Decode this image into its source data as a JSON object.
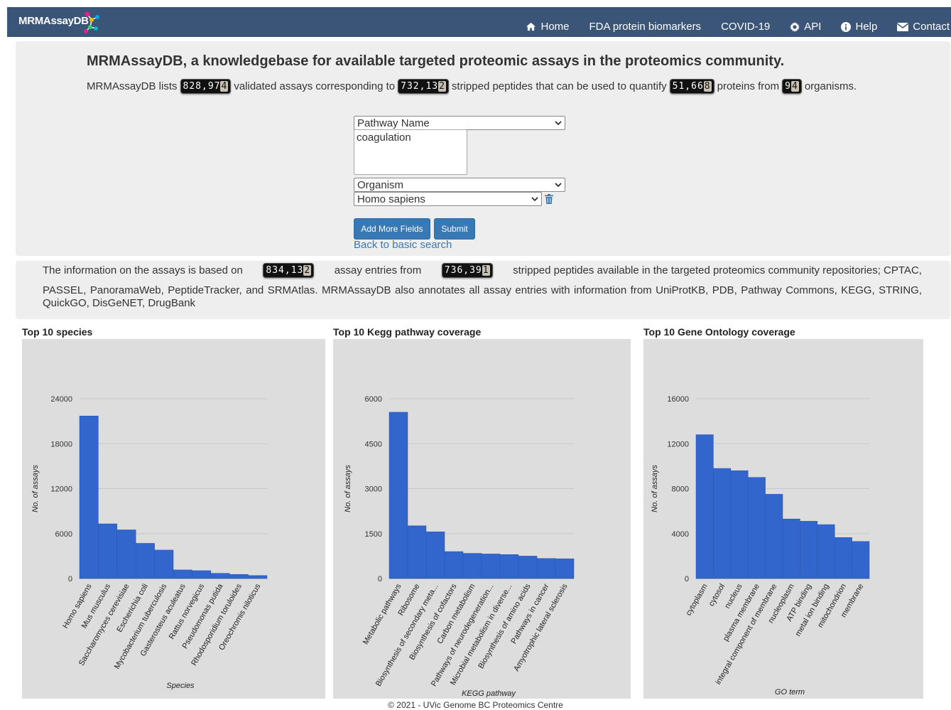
{
  "brand": {
    "name": "MRMAssayDB"
  },
  "nav": [
    {
      "label": "Home",
      "icon": "home-icon"
    },
    {
      "label": "FDA protein biomarkers",
      "icon": ""
    },
    {
      "label": "COVID-19",
      "icon": ""
    },
    {
      "label": "API",
      "icon": "gear-icon"
    },
    {
      "label": "Help",
      "icon": "info-icon"
    },
    {
      "label": "Contact",
      "icon": "envelope-icon"
    }
  ],
  "search": {
    "headline": "MRMAssayDB, a knowledgebase for available targeted proteomic assays in the proteomics community.",
    "stats_prefix": "MRMAssayDB lists",
    "stats_assays": "828,974",
    "stats_mid1": "validated assays corresponding to",
    "stats_peptides": "732,132",
    "stats_mid2": "stripped peptides that can be used to quantify",
    "stats_proteins": "51,668",
    "stats_mid3": "proteins from",
    "stats_organisms": "94",
    "stats_suffix": "organisms.",
    "field1_select": "Pathway Name",
    "field1_value": "coagulation",
    "field2_select": "Organism",
    "field2_value": "Homo sapiens",
    "add_fields_label": "Add More Fields",
    "submit_label": "Submit",
    "back_link": "Back to basic search"
  },
  "info": {
    "p1": "The information on the assays is based on",
    "entries": "834,132",
    "p2": "assay entries from",
    "peptides": "736,391",
    "p3": "stripped peptides available in the targeted proteomics community repositories; CPTAC,",
    "p4": "PASSEL, PanoramaWeb, PeptideTracker, and SRMAtlas. MRMAssayDB also annotates all assay entries with information from UniProtKB, PDB, Pathway Commons, KEGG, STRING, QuickGO, DisGeNET, DrugBank"
  },
  "chart_data": [
    {
      "type": "bar",
      "title": "Top 10 species",
      "xlabel": "Species",
      "ylabel": "No. of assays",
      "ylim": [
        0,
        24000
      ],
      "yticks": [
        "0",
        "6000",
        "12000",
        "18000",
        "24000"
      ],
      "categories": [
        "Homo sapiens",
        "Mus musculus",
        "Saccharomyces cerevisiae",
        "Escherichia coli",
        "Mycobacterium tuberculosis",
        "Gasterosteus aculeatus",
        "Rattus norvegicus",
        "Pseudomonas putida",
        "Rhodosporidium toruloides",
        "Oreochromis niloticus"
      ],
      "values": [
        21700,
        7300,
        6500,
        4700,
        3800,
        1150,
        1050,
        700,
        550,
        400
      ],
      "color": "#3366cc",
      "grid": true
    },
    {
      "type": "bar",
      "title": "Top 10 Kegg pathway coverage",
      "xlabel": "KEGG pathway",
      "ylabel": "No. of assays",
      "ylim": [
        0,
        6000
      ],
      "yticks": [
        "0",
        "1500",
        "3000",
        "4500",
        "6000"
      ],
      "categories": [
        "Metabolic pathways",
        "Ribosome",
        "Biosynthesis of secondary meta...",
        "Biosynthesis of cofactors",
        "Carbon metabolism",
        "Pathways of neurodegeneration...",
        "Microbial metabolism in diverse...",
        "Biosynthesis of amino acids",
        "Pathways in cancer",
        "Amyotrophic lateral sclerosis"
      ],
      "values": [
        5550,
        1760,
        1560,
        900,
        840,
        820,
        800,
        750,
        670,
        660
      ],
      "color": "#3366cc",
      "grid": true
    },
    {
      "type": "bar",
      "title": "Top 10 Gene Ontology coverage",
      "xlabel": "GO term",
      "ylabel": "No. of assays",
      "ylim": [
        0,
        16000
      ],
      "yticks": [
        "0",
        "4000",
        "8000",
        "12000",
        "16000"
      ],
      "categories": [
        "cytoplasm",
        "cytosol",
        "nucleus",
        "plasma membrane",
        "integral component of membrane",
        "nucleoplasm",
        "ATP binding",
        "metal ion binding",
        "mitochondrion",
        "membrane"
      ],
      "values": [
        12800,
        9800,
        9600,
        9000,
        7500,
        5300,
        5100,
        4800,
        3650,
        3300
      ],
      "color": "#3366cc",
      "grid": true
    }
  ],
  "footer": "© 2021 - UVic Genome BC Proteomics Centre"
}
